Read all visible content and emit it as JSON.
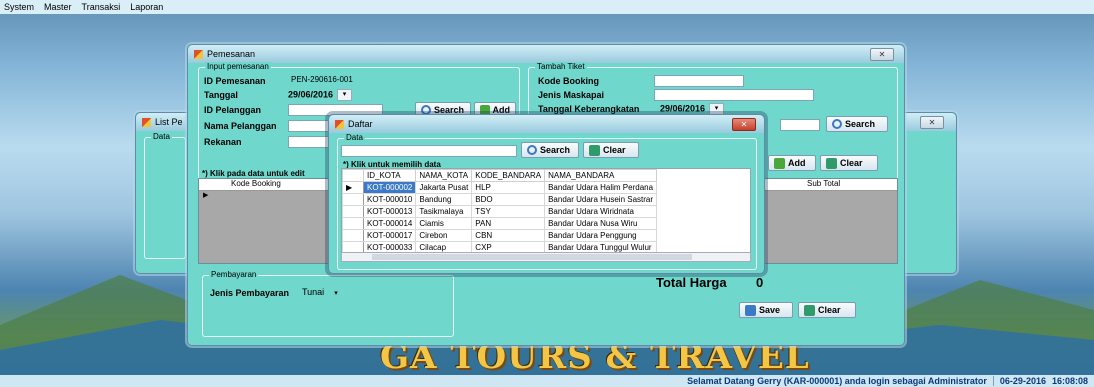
{
  "menu": {
    "items": [
      "System",
      "Master",
      "Transaksi",
      "Laporan"
    ]
  },
  "status": {
    "welcome": "Selamat Datang Gerry (KAR-000001) anda login sebagai Administrator",
    "date": "06-29-2016",
    "time": "16:08:08"
  },
  "brand": "GA TOURS & TRAVEL",
  "list_window": {
    "title": "List Pe",
    "group_label": "Data",
    "close": "✕"
  },
  "pemesanan": {
    "title": "Pemesanan",
    "close": "✕",
    "input_group": "Input pemesanan",
    "id_label": "ID Pemesanan",
    "id_value": "PEN-290616-001",
    "tanggal_label": "Tanggal",
    "tanggal_value": "29/06/2016",
    "pelanggan_label": "ID Pelanggan",
    "nama_label": "Nama Pelanggan",
    "rekanan_label": "Rekanan",
    "search_label": "Search",
    "add_label": "Add",
    "note": "*) Klik pada data untuk edit",
    "tiket_group": "Tambah Tiket",
    "kode_label": "Kode Booking",
    "maskapai_label": "Jenis Maskapai",
    "keberangkatan_label": "Tanggal Keberangkatan",
    "keberangkatan_value": "29/06/2016",
    "search2_label": "Search",
    "add2_label": "Add",
    "clear_label": "Clear",
    "grid_col_kode": "Kode Booking",
    "grid_col_subtotal": "Sub Total",
    "pembayaran_group": "Pembayaran",
    "jenis_label": "Jenis Pembayaran",
    "jenis_value": "Tunai",
    "total_label": "Total Harga",
    "total_value": "0",
    "save_label": "Save",
    "clear2_label": "Clear"
  },
  "daftar": {
    "title": "Daftar",
    "group_label": "Data",
    "search_label": "Search",
    "clear_label": "Clear",
    "note": "*) Klik untuk memilih data",
    "columns": [
      "ID_KOTA",
      "NAMA_KOTA",
      "KODE_BANDARA",
      "NAMA_BANDARA"
    ],
    "rows": [
      [
        "KOT-000002",
        "Jakarta Pusat",
        "HLP",
        "Bandar Udara Halim Perdana"
      ],
      [
        "KOT-000010",
        "Bandung",
        "BDO",
        "Bandar Udara Husein Sastrar"
      ],
      [
        "KOT-000013",
        "Tasikmalaya",
        "TSY",
        "Bandar Udara Wiridnata"
      ],
      [
        "KOT-000014",
        "Ciamis",
        "PAN",
        "Bandar Udara Nusa Wiru"
      ],
      [
        "KOT-000017",
        "Cirebon",
        "CBN",
        "Bandar Udara Penggung"
      ],
      [
        "KOT-000033",
        "Cilacap",
        "CXP",
        "Bandar Udara Tunggul Wulur"
      ]
    ]
  }
}
